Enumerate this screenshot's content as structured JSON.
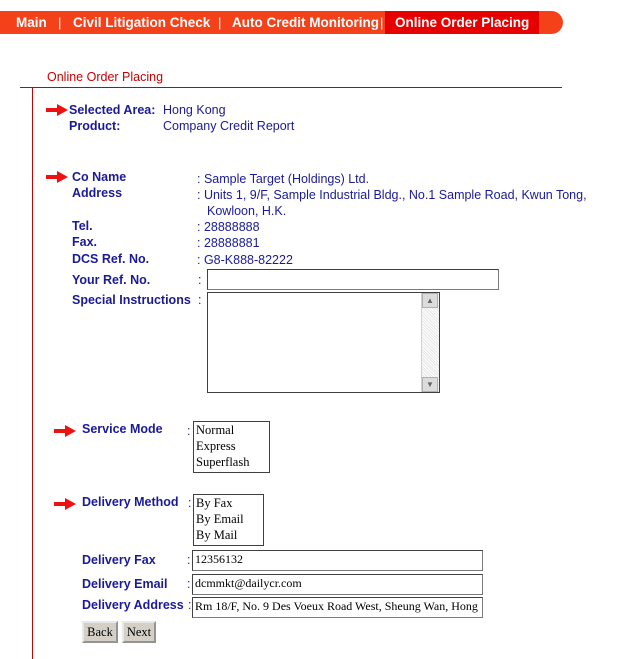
{
  "nav": {
    "items": [
      "Main",
      "Civil Litigation Check",
      "Auto Credit Monitoring",
      "Online Order Placing"
    ],
    "separator": "|",
    "active": "Online Order Placing"
  },
  "page_title": "Online Order Placing",
  "order": {
    "selected_area_label": "Selected Area:",
    "selected_area_value": "Hong Kong",
    "product_label": "Product:",
    "product_value": "Company Credit Report"
  },
  "company": {
    "co_name_label": "Co Name",
    "co_name_value": ": Sample Target (Holdings) Ltd.",
    "address_label": "Address",
    "address_line1": ": Units 1, 9/F, Sample Industrial Bldg., No.1 Sample Road, Kwun Tong,",
    "address_line2": "Kowloon, H.K.",
    "tel_label": "Tel.",
    "tel_value": ": 28888888",
    "fax_label": "Fax.",
    "fax_value": ": 28888881",
    "dcs_label": "DCS Ref. No.",
    "dcs_value": ": G8-K888-82222",
    "your_ref_label": "Your Ref. No.",
    "your_ref_value": "",
    "special_label": "Special Instructions",
    "special_value": ""
  },
  "service_mode": {
    "label": "Service Mode",
    "options": [
      "Normal",
      "Express",
      "Superflash"
    ]
  },
  "delivery_method": {
    "label": "Delivery Method",
    "options": [
      "By Fax",
      "By Email",
      "By Mail"
    ]
  },
  "delivery": {
    "fax_label": "Delivery Fax",
    "fax_value": "12356132",
    "email_label": "Delivery Email",
    "email_value": "dcmmkt@dailycr.com",
    "address_label": "Delivery Address",
    "address_value": "Rm 18/F, No. 9 Des Voeux Road West, Sheung Wan, Hong"
  },
  "buttons": {
    "back": "Back",
    "next": "Next"
  },
  "colors": {
    "nav_bg": "#f5411a",
    "nav_active": "#e60000",
    "label_blue": "#1a1a99",
    "accent_red": "#cc0000"
  }
}
